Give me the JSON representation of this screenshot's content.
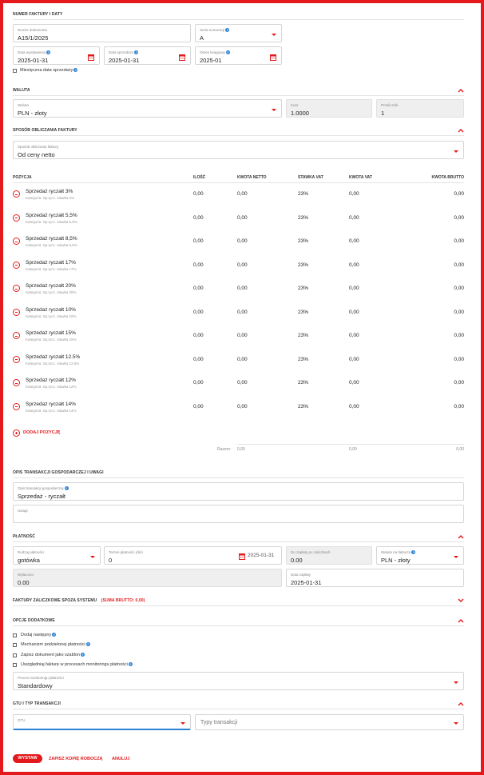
{
  "invoice_number": {
    "section_title": "Numer faktury i daty",
    "document_number": {
      "label": "Numer dokumentu",
      "value": "A15/1/2025"
    },
    "numbering_series": {
      "label": "Seria numeracji",
      "value": "A"
    },
    "issue_date": {
      "label": "Data wystawienia",
      "value": "2025-01-31"
    },
    "sale_date": {
      "label": "Data sprzedaży",
      "value": "2025-01-31"
    },
    "accounting_period": {
      "label": "Okres księgowy",
      "value": "2025-01"
    },
    "monthly_sale_date_label": "Miesięczna data sprzedaży"
  },
  "currency": {
    "section_title": "Waluta",
    "currency": {
      "label": "Waluta",
      "value": "PLN - złoty"
    },
    "rate": {
      "label": "Kurs",
      "value": "1.0000"
    },
    "multiplier": {
      "label": "Przelicznik",
      "value": "1"
    }
  },
  "calc_method": {
    "section_title": "Sposób obliczania faktury",
    "field": {
      "label": "Sposób obliczania faktury",
      "value": "Od ceny netto"
    }
  },
  "table": {
    "headers": {
      "position": "Pozycja",
      "qty": "Ilość",
      "net": "Kwota netto",
      "vat_rate": "Stawka VAT",
      "vat": "Kwota VAT",
      "gross": "Kwota brutto"
    },
    "rows": [
      {
        "name": "Sprzedaż ryczałt 3%",
        "category": "Kategoria: Sp.rycz. stawka 3%",
        "qty": "0,00",
        "net": "0,00",
        "vat_rate": "23%",
        "vat": "0,00",
        "gross": "0,00"
      },
      {
        "name": "Sprzedaż ryczałt 5,5%",
        "category": "Kategoria: Sp.rycz. stawka 5,5%",
        "qty": "0,00",
        "net": "0,00",
        "vat_rate": "23%",
        "vat": "0,00",
        "gross": "0,00"
      },
      {
        "name": "Sprzedaż ryczałt 8,5%",
        "category": "Kategoria: Sp.rycz. stawka 8,5%",
        "qty": "0,00",
        "net": "0,00",
        "vat_rate": "23%",
        "vat": "0,00",
        "gross": "0,00"
      },
      {
        "name": "Sprzedaż ryczałt 17%",
        "category": "Kategoria: Sp.rycz. stawka 17%",
        "qty": "0,00",
        "net": "0,00",
        "vat_rate": "23%",
        "vat": "0,00",
        "gross": "0,00"
      },
      {
        "name": "Sprzedaż ryczałt 20%",
        "category": "Kategoria: Sp.rycz. stawka 20%",
        "qty": "0,00",
        "net": "0,00",
        "vat_rate": "23%",
        "vat": "0,00",
        "gross": "0,00"
      },
      {
        "name": "Sprzedaż ryczałt 10%",
        "category": "Kategoria: Sp.rycz. stawka 10%",
        "qty": "0,00",
        "net": "0,00",
        "vat_rate": "23%",
        "vat": "0,00",
        "gross": "0,00"
      },
      {
        "name": "Sprzedaż ryczałt 15%",
        "category": "Kategoria: Sp.rycz. stawka 15%",
        "qty": "0,00",
        "net": "0,00",
        "vat_rate": "23%",
        "vat": "0,00",
        "gross": "0,00"
      },
      {
        "name": "Sprzedaż ryczałt 12.5%",
        "category": "Kategoria: Sp.rycz. stawka 12.5%",
        "qty": "0,00",
        "net": "0,00",
        "vat_rate": "23%",
        "vat": "0,00",
        "gross": "0,00"
      },
      {
        "name": "Sprzedaż ryczałt 12%",
        "category": "Kategoria: Sp.rycz. stawka 12%",
        "qty": "0,00",
        "net": "0,00",
        "vat_rate": "23%",
        "vat": "0,00",
        "gross": "0,00"
      },
      {
        "name": "Sprzedaż ryczałt 14%",
        "category": "Kategoria: Sp.rycz. stawka 14%",
        "qty": "0,00",
        "net": "0,00",
        "vat_rate": "23%",
        "vat": "0,00",
        "gross": "0,00"
      }
    ],
    "add_position_label": "Dodaj pozycję",
    "total": {
      "label": "Razem:",
      "net": "0,00",
      "vat": "0,00",
      "gross": "0,00"
    }
  },
  "transaction_desc": {
    "section_title": "Opis transakcji gospodarczej i uwagi",
    "description": {
      "label": "Opis transakcji gospodarczej",
      "value": "Sprzedaż - ryczałt"
    },
    "notes": {
      "label": "Uwagi",
      "value": ""
    }
  },
  "payment": {
    "section_title": "Płatność",
    "type": {
      "label": "Rodzaj płatności",
      "value": "gotówka"
    },
    "term": {
      "label": "Termin płatności (dni)",
      "value": "0",
      "date": "2025-01-31"
    },
    "to_pay": {
      "label": "Do zapłaty po zaliczkach",
      "value": "0.00"
    },
    "currency_on_invoice": {
      "label": "Waluta na fakturze",
      "value": "PLN - złoty"
    },
    "paid": {
      "label": "Wpłacono",
      "value": "0.00"
    },
    "payment_date": {
      "label": "Data zapłaty",
      "value": "2025-01-31"
    }
  },
  "advance_invoices": {
    "section_title": "Faktury zaliczkowe spoza systemu",
    "sum_label": "(SUMA BRUTTO: 0,00)"
  },
  "extra_options": {
    "section_title": "Opcje dodatkowe",
    "options": [
      "Dodaj następny",
      "Mechanizm podzielonej płatności",
      "Zapisz dokument jako szablon",
      "Uwzględniaj fakturę w procesach monitoringu płatności"
    ],
    "monitoring": {
      "label": "Proces monitoringu płatności",
      "value": "Standardowy"
    }
  },
  "transaction_type": {
    "section_title": "GTU i typ transakcji",
    "gtu": {
      "label": "GTU",
      "value": ""
    },
    "types": {
      "placeholder": "Typy transakcji"
    }
  },
  "footer": {
    "issue": "Wystaw",
    "save_draft": "Zapisz kopię roboczą",
    "cancel": "Anuluj"
  },
  "colors": {
    "accent": "#e3191b",
    "info": "#2a82d6",
    "border": "#d5d5d5"
  }
}
